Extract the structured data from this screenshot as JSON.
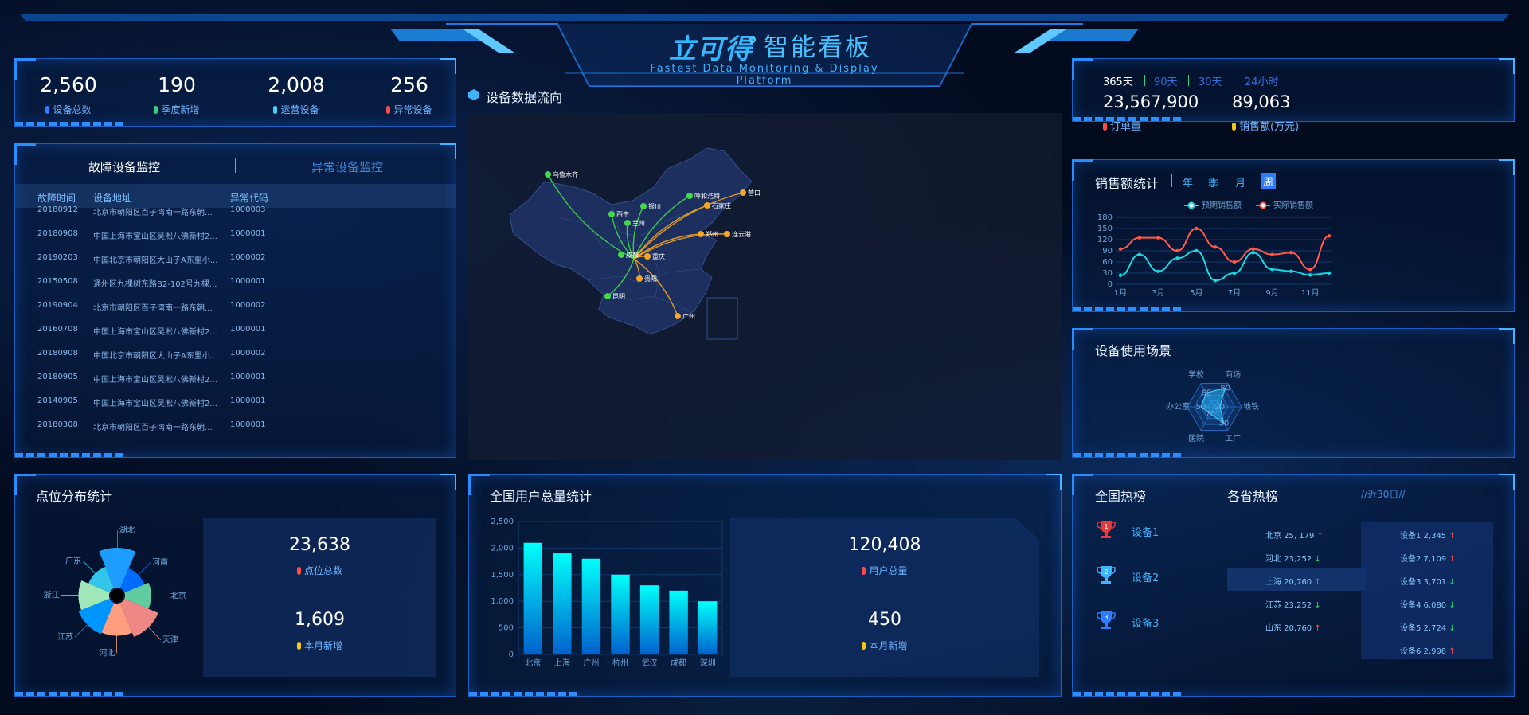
{
  "header": {
    "logo": "立可得",
    "title": "智能看板",
    "subtitle": "Fastest Data Monitoring & Display Platform"
  },
  "stats": [
    {
      "value": "2,560",
      "label": "设备总数",
      "color": "#2f7cff"
    },
    {
      "value": "190",
      "label": "季度新增",
      "color": "#35d07f"
    },
    {
      "value": "2,008",
      "label": "运营设备",
      "color": "#3fd2ff"
    },
    {
      "value": "256",
      "label": "异常设备",
      "color": "#ff4a4a"
    }
  ],
  "monitor": {
    "tab_active": "故障设备监控",
    "tab_inactive": "异常设备监控",
    "columns": [
      "故障时间",
      "设备地址",
      "异常代码"
    ],
    "rows": [
      {
        "time": "20180912",
        "addr": "北京市朝阳区百子湾南一路东朝...",
        "code": "1000003"
      },
      {
        "time": "20180908",
        "addr": "中国上海市宝山区吴淞八佛新村2...",
        "code": "1000001"
      },
      {
        "time": "20190203",
        "addr": "中国北京市朝阳区大山子A东里小...",
        "code": "1000002"
      },
      {
        "time": "20150508",
        "addr": "通州区九棵树东路B2-102号九棵...",
        "code": "1000001"
      },
      {
        "time": "20190904",
        "addr": "北京市朝阳区百子湾南一路东朝...",
        "code": "1000002"
      },
      {
        "time": "20160708",
        "addr": "中国上海市宝山区吴淞八佛新村2...",
        "code": "1000001"
      },
      {
        "time": "20180908",
        "addr": "中国北京市朝阳区大山子A东里小...",
        "code": "1000002"
      },
      {
        "time": "20180905",
        "addr": "中国上海市宝山区吴淞八佛新村2...",
        "code": "1000001"
      },
      {
        "time": "20140905",
        "addr": "中国上海市宝山区吴淞八佛新村2...",
        "code": "1000001"
      },
      {
        "time": "20180308",
        "addr": "北京市朝阳区百子湾南一路东朝...",
        "code": "1000001"
      }
    ]
  },
  "map": {
    "title": "设备数据流向",
    "cities": [
      "乌鲁木齐",
      "呼和浩特",
      "营口",
      "银川",
      "石家庄",
      "西宁",
      "兰州",
      "郑州",
      "连云港",
      "成都",
      "重庆",
      "贵阳",
      "昆明",
      "广州"
    ]
  },
  "orders": {
    "tabs": [
      "365天",
      "90天",
      "30天",
      "24小时"
    ],
    "order_value": "23,567,900",
    "order_label": "订单量",
    "sales_value": "89,063",
    "sales_label": "销售额(万元)"
  },
  "sales": {
    "title": "销售额统计",
    "tabs": [
      "年",
      "季",
      "月",
      "周"
    ],
    "legend": [
      "预期销售额",
      "实际销售额"
    ]
  },
  "scene": {
    "title": "设备使用场景"
  },
  "points": {
    "title": "点位分布统计",
    "total_value": "23,638",
    "total_label": "点位总数",
    "new_value": "1,609",
    "new_label": "本月新增"
  },
  "users": {
    "title": "全国用户总量统计",
    "total_value": "120,408",
    "total_label": "用户总量",
    "new_value": "450",
    "new_label": "本月新增"
  },
  "hot": {
    "title_all": "全国热榜",
    "title_prov": "各省热榜",
    "period": "//近30日//",
    "devices": [
      "设备1",
      "设备2",
      "设备3"
    ],
    "provinces": [
      {
        "text": "北京 25, 179",
        "dir": "up"
      },
      {
        "text": "河北 23,252",
        "dir": "down"
      },
      {
        "text": "上海 20,760",
        "dir": "up"
      },
      {
        "text": "江苏 23,252",
        "dir": "down"
      },
      {
        "text": "山东 20,760",
        "dir": "up"
      }
    ],
    "items": [
      {
        "text": "设备1 2,345",
        "dir": "up"
      },
      {
        "text": "设备2 7,109",
        "dir": "up"
      },
      {
        "text": "设备3 3,701",
        "dir": "down"
      },
      {
        "text": "设备4 6,080",
        "dir": "down"
      },
      {
        "text": "设备5 2,724",
        "dir": "down"
      },
      {
        "text": "设备6 2,998",
        "dir": "up"
      }
    ]
  },
  "chart_data": [
    {
      "type": "line",
      "categories": [
        "1月",
        "2月",
        "3月",
        "4月",
        "5月",
        "6月",
        "7月",
        "8月",
        "9月",
        "10月",
        "11月",
        "12月"
      ],
      "xticks": [
        "1月",
        "3月",
        "5月",
        "7月",
        "9月",
        "11月"
      ],
      "ylim": [
        0,
        180
      ],
      "yticks": [
        0,
        30,
        60,
        90,
        120,
        150,
        180
      ],
      "series": [
        {
          "name": "预期销售额",
          "values": [
            24,
            80,
            35,
            70,
            90,
            10,
            30,
            85,
            40,
            35,
            25,
            30
          ],
          "color": "#19d7e0"
        },
        {
          "name": "实际销售额",
          "values": [
            95,
            125,
            125,
            90,
            150,
            100,
            60,
            95,
            80,
            85,
            40,
            130
          ],
          "color": "#ff5a4a"
        }
      ]
    },
    {
      "type": "radar",
      "indicators": [
        "商场",
        "地铁",
        "工厂",
        "医院",
        "办公室",
        "学校"
      ],
      "ticks": [
        "80",
        "20",
        "30",
        "70",
        "50",
        "60"
      ],
      "values": [
        80,
        20,
        70,
        30,
        50,
        60
      ],
      "max": 100
    },
    {
      "type": "pie",
      "rose": true,
      "labels": [
        "河南",
        "北京",
        "天津",
        "河北",
        "江苏",
        "浙江",
        "广东",
        "湖北"
      ],
      "values": [
        20,
        26,
        40,
        34,
        36,
        32,
        22,
        44
      ],
      "colors": [
        "#006cff",
        "#60cda0",
        "#ed8884",
        "#ff9f7f",
        "#0096ff",
        "#9fe6b8",
        "#32c5e9",
        "#1d9dff"
      ]
    },
    {
      "type": "bar",
      "categories": [
        "北京",
        "上海",
        "广州",
        "杭州",
        "武汉",
        "成都",
        "深圳"
      ],
      "values": [
        2100,
        1900,
        1800,
        1500,
        1300,
        1200,
        1000
      ],
      "ylim": [
        0,
        2500
      ],
      "yticks": [
        "0",
        "500",
        "1,000",
        "1,500",
        "2,000",
        "2,500"
      ]
    }
  ]
}
